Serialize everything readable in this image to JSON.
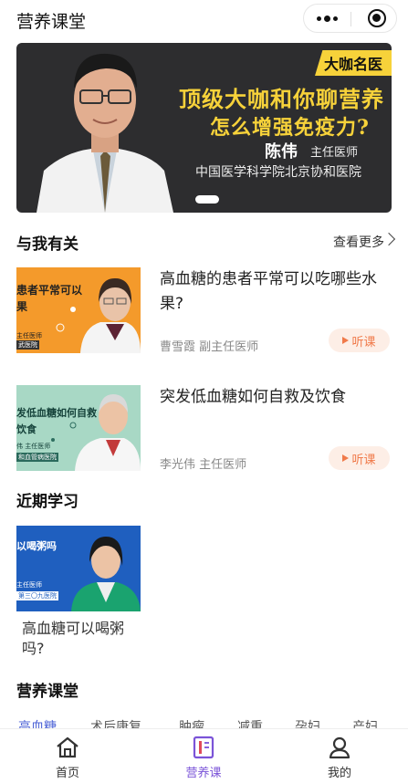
{
  "header": {
    "title": "营养课堂",
    "more_icon": "more-dots-icon",
    "close_icon": "target-close-icon"
  },
  "banner": {
    "badge": "大咖名医",
    "headline_1": "顶级大咖和你聊营养",
    "headline_2": "怎么增强免疫力?",
    "doctor_name": "陈伟",
    "doctor_title": "主任医师",
    "hospital": "中国医学科学院北京协和医院",
    "accent_color": "#f7d23a"
  },
  "related": {
    "section_title": "与我有关",
    "more_label": "查看更多",
    "listen_label": "听课",
    "courses": [
      {
        "title": "高血糖的患者平常可以吃哪些水果?",
        "meta": "曹雪霞 副主任医师",
        "thumb_text_1": "患者平常可以",
        "thumb_text_2": "果",
        "thumb_text_3": "主任医师",
        "thumb_text_4": "武医院"
      },
      {
        "title": "突发低血糖如何自救及饮食",
        "meta": "李光伟 主任医师",
        "thumb_text_1": "发低血糖如何自救",
        "thumb_text_2": "饮食",
        "thumb_text_3": "伟 主任医师",
        "thumb_text_4": "和血管病医院"
      }
    ]
  },
  "recent": {
    "section_title": "近期学习",
    "card_title": "高血糖可以喝粥吗?",
    "thumb_text_1": "以喝粥吗",
    "thumb_text_2": "主任医师",
    "thumb_text_3": "第三〇九医院"
  },
  "classroom": {
    "section_title": "营养课堂",
    "tabs": [
      "高血糖",
      "术后康复",
      "肿瘤",
      "减重",
      "孕妇",
      "产妇"
    ],
    "active_tab": 0
  },
  "bottom_nav": {
    "items": [
      {
        "label": "首页",
        "icon": "home-icon"
      },
      {
        "label": "营养课",
        "icon": "book-icon"
      },
      {
        "label": "我的",
        "icon": "user-icon"
      }
    ],
    "active_index": 1,
    "active_color": "#7b54d8"
  }
}
